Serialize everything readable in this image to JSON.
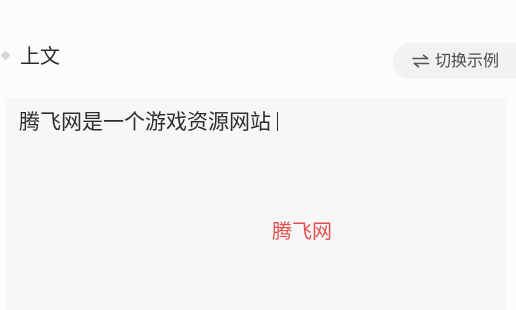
{
  "header": {
    "title": "上文",
    "switch_button_label": "切换示例"
  },
  "panel": {
    "text": "腾飞网是一个游戏资源网站",
    "highlight_text": "腾飞网"
  },
  "icons": {
    "section_marker": "diamond-marker-icon",
    "switch": "swap-arrows-icon"
  },
  "colors": {
    "page_background": "#fdfbfd",
    "panel_background": "#f7f7f7",
    "switch_background": "#f2f1f3",
    "highlight_red": "#e34f4f"
  }
}
